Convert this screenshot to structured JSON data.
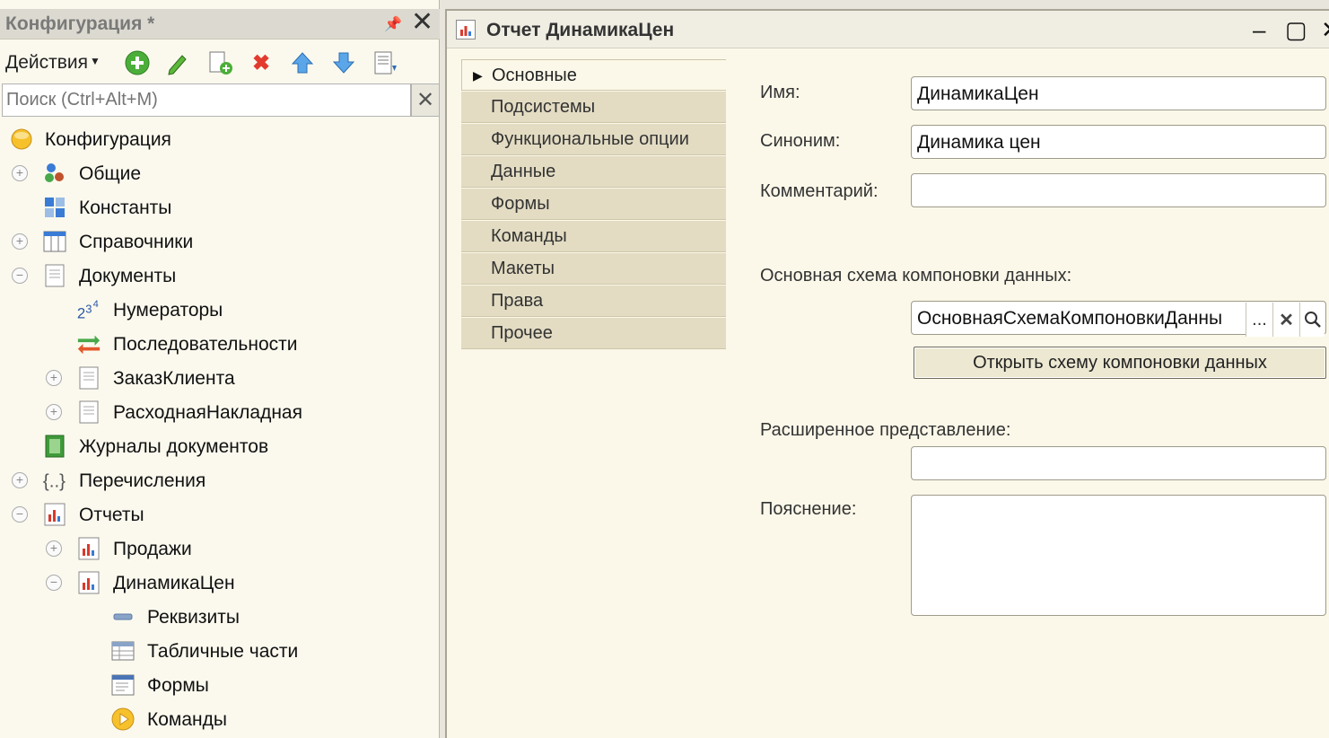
{
  "left_panel": {
    "title": "Конфигурация *",
    "pin_icon": "pin-icon",
    "close_icon": "close-icon",
    "toolbar": {
      "actions_label": "Действия",
      "icons": [
        "add-icon",
        "edit-icon",
        "copy-icon",
        "delete-icon",
        "move-up-icon",
        "move-down-icon",
        "sort-icon"
      ]
    },
    "search": {
      "placeholder": "Поиск (Ctrl+Alt+M)"
    },
    "tree": [
      {
        "label": "Конфигурация",
        "expander": "",
        "icon": "configuration-icon"
      },
      {
        "label": "Общие",
        "expander": "+",
        "icon": "common-icon"
      },
      {
        "label": "Константы",
        "expander": "",
        "icon": "constants-icon"
      },
      {
        "label": "Справочники",
        "expander": "+",
        "icon": "catalogs-icon"
      },
      {
        "label": "Документы",
        "expander": "−",
        "icon": "documents-icon"
      },
      {
        "label": "Нумераторы",
        "expander": "",
        "icon": "numerators-icon"
      },
      {
        "label": "Последовательности",
        "expander": "",
        "icon": "sequences-icon"
      },
      {
        "label": "ЗаказКлиента",
        "expander": "+",
        "icon": "document-icon"
      },
      {
        "label": "РасходнаяНакладная",
        "expander": "+",
        "icon": "document-icon"
      },
      {
        "label": "Журналы документов",
        "expander": "",
        "icon": "journals-icon"
      },
      {
        "label": "Перечисления",
        "expander": "+",
        "icon": "enums-icon"
      },
      {
        "label": "Отчеты",
        "expander": "−",
        "icon": "reports-icon"
      },
      {
        "label": "Продажи",
        "expander": "+",
        "icon": "report-icon"
      },
      {
        "label": "ДинамикаЦен",
        "expander": "−",
        "icon": "report-icon"
      },
      {
        "label": "Реквизиты",
        "expander": "",
        "icon": "attributes-icon"
      },
      {
        "label": "Табличные части",
        "expander": "",
        "icon": "tabular-sections-icon"
      },
      {
        "label": "Формы",
        "expander": "",
        "icon": "forms-icon"
      },
      {
        "label": "Команды",
        "expander": "",
        "icon": "commands-icon"
      }
    ]
  },
  "right_window": {
    "title": "Отчет ДинамикаЦен",
    "tabs": [
      "Основные",
      "Подсистемы",
      "Функциональные опции",
      "Данные",
      "Формы",
      "Команды",
      "Макеты",
      "Права",
      "Прочее"
    ],
    "active_tab": "Основные",
    "form": {
      "name_label": "Имя:",
      "name_value": "ДинамикаЦен",
      "synonym_label": "Синоним:",
      "synonym_value": "Динамика цен",
      "comment_label": "Комментарий:",
      "comment_value": "",
      "schema_label": "Основная схема компоновки данных:",
      "schema_value": "ОсновнаяСхемаКомпоновкиДанны",
      "schema_select": "...",
      "open_schema_button": "Открыть схему компоновки данных",
      "extended_repr_label": "Расширенное представление:",
      "extended_repr_value": "",
      "explanation_label": "Пояснение:",
      "explanation_value": ""
    }
  }
}
